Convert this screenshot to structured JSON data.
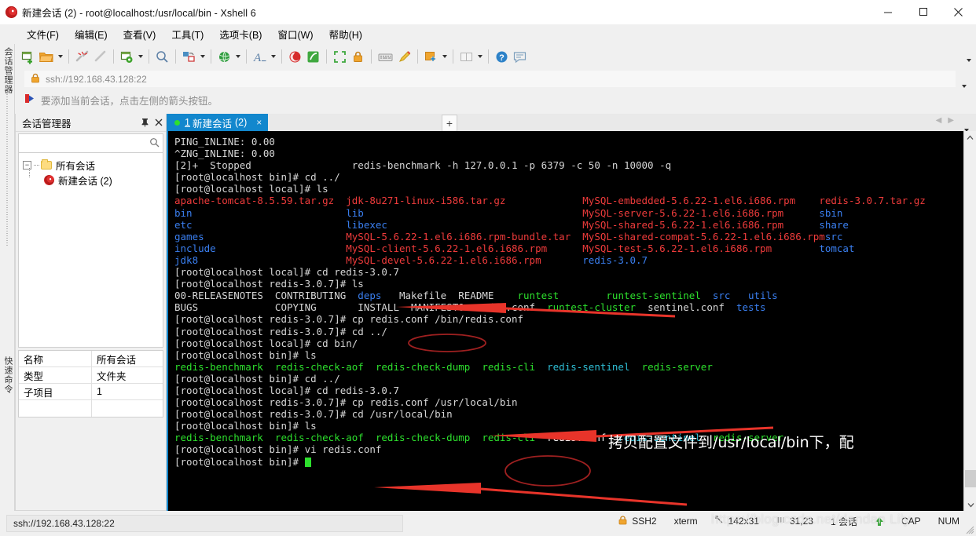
{
  "window": {
    "title": "新建会话 (2) - root@localhost:/usr/local/bin - Xshell 6",
    "minimize": "—",
    "maximize": "▢",
    "close": "✕"
  },
  "menu": {
    "items": [
      {
        "label": "文件(F)"
      },
      {
        "label": "编辑(E)"
      },
      {
        "label": "查看(V)"
      },
      {
        "label": "工具(T)"
      },
      {
        "label": "选项卡(B)"
      },
      {
        "label": "窗口(W)"
      },
      {
        "label": "帮助(H)"
      }
    ]
  },
  "address": {
    "value": "ssh://192.168.43.128:22",
    "placeholder": "ssh://"
  },
  "hint": {
    "text": "要添加当前会话，点击左侧的箭头按钮。"
  },
  "leftstrip": {
    "tab_top": "会话管理器",
    "tab_bottom": "快速命令"
  },
  "session_panel": {
    "title": "会话管理器",
    "pin": "⇱",
    "close": "✕",
    "search_placeholder": "",
    "search_value": "",
    "tree": {
      "root": "所有会话",
      "child": "新建会话 (2)",
      "expander": "−"
    },
    "properties": [
      {
        "key": "名称",
        "value": "所有会话"
      },
      {
        "key": "类型",
        "value": "文件夹"
      },
      {
        "key": "子项目",
        "value": "1"
      }
    ]
  },
  "tabs": {
    "active": {
      "number": "1",
      "label": "新建会话",
      "suffix": "(2)",
      "close": "×"
    },
    "new_tab": "+",
    "nav_prev": "◀",
    "nav_next": "▶"
  },
  "terminal": {
    "lines": [
      [
        {
          "t": "PING_INLINE: 0.00",
          "c": "w"
        }
      ],
      [
        {
          "t": "^ZNG_INLINE: 0.00",
          "c": "w"
        }
      ],
      [
        {
          "t": "[2]+  Stopped                 redis-benchmark -h 127.0.0.1 -p 6379 -c 50 -n 10000 -q",
          "c": "w"
        }
      ],
      [
        {
          "t": "[root@localhost bin]# cd ../",
          "c": "w"
        }
      ],
      [
        {
          "t": "[root@localhost local]# ls",
          "c": "w"
        }
      ],
      [
        {
          "t": "apache-tomcat-8.5.59.tar.gz  ",
          "c": "red"
        },
        {
          "t": "jdk-8u271-linux-i586.tar.gz             ",
          "c": "red"
        },
        {
          "t": "MySQL-embedded-5.6.22-1.el6.i686.rpm    ",
          "c": "red"
        },
        {
          "t": "redis-3.0.7.tar.gz",
          "c": "red"
        }
      ],
      [
        {
          "t": "bin                          ",
          "c": "blue"
        },
        {
          "t": "lib                                     ",
          "c": "blue"
        },
        {
          "t": "MySQL-server-5.6.22-1.el6.i686.rpm      ",
          "c": "red"
        },
        {
          "t": "sbin",
          "c": "blue"
        }
      ],
      [
        {
          "t": "etc                          ",
          "c": "blue"
        },
        {
          "t": "libexec                                 ",
          "c": "blue"
        },
        {
          "t": "MySQL-shared-5.6.22-1.el6.i686.rpm      ",
          "c": "red"
        },
        {
          "t": "share",
          "c": "blue"
        }
      ],
      [
        {
          "t": "games                        ",
          "c": "blue"
        },
        {
          "t": "MySQL-5.6.22-1.el6.i686.rpm-bundle.tar  ",
          "c": "red"
        },
        {
          "t": "MySQL-shared-compat-5.6.22-1.el6.i686.rpm",
          "c": "red"
        },
        {
          "t": "src",
          "c": "blue"
        }
      ],
      [
        {
          "t": "include                      ",
          "c": "blue"
        },
        {
          "t": "MySQL-client-5.6.22-1.el6.i686.rpm      ",
          "c": "red"
        },
        {
          "t": "MySQL-test-5.6.22-1.el6.i686.rpm        ",
          "c": "red"
        },
        {
          "t": "tomcat",
          "c": "blue"
        }
      ],
      [
        {
          "t": "jdk8                         ",
          "c": "blue"
        },
        {
          "t": "MySQL-devel-5.6.22-1.el6.i686.rpm       ",
          "c": "red"
        },
        {
          "t": "redis-3.0.7",
          "c": "blue"
        }
      ],
      [
        {
          "t": "[root@localhost local]# cd redis-3.0.7",
          "c": "w"
        }
      ],
      [
        {
          "t": "[root@localhost redis-3.0.7]# ls",
          "c": "w"
        }
      ],
      [
        {
          "t": "00-RELEASENOTES  CONTRIBUTING  ",
          "c": "w"
        },
        {
          "t": "deps   ",
          "c": "blue"
        },
        {
          "t": "Makefile  README    ",
          "c": "w"
        },
        {
          "t": "runtest        ",
          "c": "green"
        },
        {
          "t": "runtest-sentinel  ",
          "c": "green"
        },
        {
          "t": "src   ",
          "c": "blue"
        },
        {
          "t": "utils",
          "c": "blue"
        }
      ],
      [
        {
          "t": "BUGS             COPYING       INSTALL  MANIFESTO  redis.conf  ",
          "c": "w"
        },
        {
          "t": "runtest-cluster  ",
          "c": "green"
        },
        {
          "t": "sentinel.conf  ",
          "c": "w"
        },
        {
          "t": "tests",
          "c": "blue"
        }
      ],
      [
        {
          "t": "[root@localhost redis-3.0.7]# cp redis.conf /bin/redis.conf",
          "c": "w"
        }
      ],
      [
        {
          "t": "[root@localhost redis-3.0.7]# cd ../",
          "c": "w"
        }
      ],
      [
        {
          "t": "[root@localhost local]# cd bin/",
          "c": "w"
        }
      ],
      [
        {
          "t": "[root@localhost bin]# ls",
          "c": "w"
        }
      ],
      [
        {
          "t": "redis-benchmark  redis-check-aof  redis-check-dump  redis-cli  ",
          "c": "green"
        },
        {
          "t": "redis-sentinel  ",
          "c": "cyan"
        },
        {
          "t": "redis-server",
          "c": "green"
        }
      ],
      [
        {
          "t": "[root@localhost bin]# cd ../",
          "c": "w"
        }
      ],
      [
        {
          "t": "[root@localhost local]# cd redis-3.0.7",
          "c": "w"
        }
      ],
      [
        {
          "t": "[root@localhost redis-3.0.7]# cp redis.conf /usr/local/bin",
          "c": "w"
        }
      ],
      [
        {
          "t": "[root@localhost redis-3.0.7]# cd /usr/local/bin",
          "c": "w"
        }
      ],
      [
        {
          "t": "[root@localhost bin]# ls",
          "c": "w"
        }
      ],
      [
        {
          "t": "redis-benchmark  redis-check-aof  redis-check-dump  redis-cli  ",
          "c": "green"
        },
        {
          "t": "redis.conf  ",
          "c": "wh"
        },
        {
          "t": "redis-sentinel  ",
          "c": "cyan"
        },
        {
          "t": "redis-server",
          "c": "green"
        }
      ],
      [
        {
          "t": "[root@localhost bin]# vi redis.conf",
          "c": "w"
        }
      ],
      [
        {
          "t": "[root@localhost bin]# ",
          "c": "w"
        },
        {
          "t": "CURSOR",
          "c": "cursor"
        }
      ]
    ],
    "annotation": "拷贝配置文件到/usr/local/bin下，配",
    "annotation_color": "#ffffff",
    "arrow_color": "#e8342a",
    "circle_color": "#b02020"
  },
  "statusbar": {
    "connection": "ssh://192.168.43.128:22",
    "protocol": "SSH2",
    "term_type": "xterm",
    "size": "142x31",
    "cursor": "31,23",
    "sessions": "1 会话",
    "caps": "CAP",
    "num": "NUM",
    "watermark": "https://blog.csdn.net/dandan Lily"
  }
}
